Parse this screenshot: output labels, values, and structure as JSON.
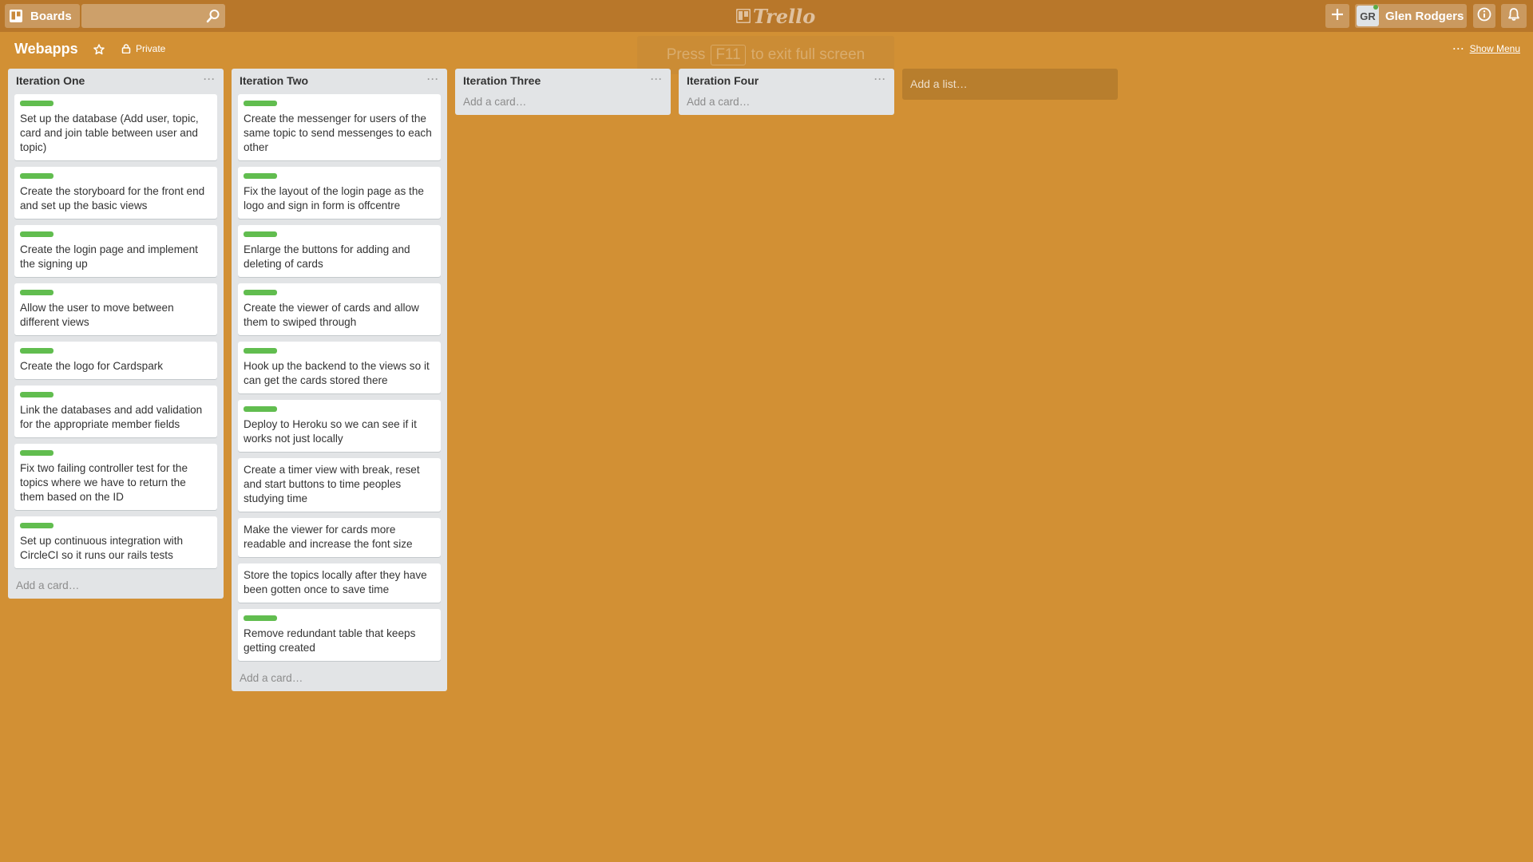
{
  "header": {
    "boards_label": "Boards",
    "search_placeholder": "",
    "logo_text": "Trello",
    "user_initials": "GR",
    "user_name": "Glen Rodgers"
  },
  "board": {
    "title": "Webapps",
    "visibility": "Private",
    "show_menu": "Show Menu",
    "fullscreen_notice": {
      "prefix": "Press",
      "key": "F11",
      "suffix": "to exit full screen"
    }
  },
  "colors": {
    "background": "#d29034",
    "header": "#b8772a",
    "label_green": "#61bd4f",
    "list_bg": "#e2e4e6"
  },
  "lists": [
    {
      "title": "Iteration One",
      "add_card": "Add a card…",
      "cards": [
        {
          "text": "Set up the database (Add user, topic, card and join table between user and topic)",
          "label": "green"
        },
        {
          "text": "Create the storyboard for the front end and set up the basic views",
          "label": "green"
        },
        {
          "text": "Create the login page and implement the signing up",
          "label": "green"
        },
        {
          "text": "Allow the user to move between different views",
          "label": "green"
        },
        {
          "text": "Create the logo for Cardspark",
          "label": "green"
        },
        {
          "text": "Link the databases and add validation for the appropriate member fields",
          "label": "green"
        },
        {
          "text": "Fix two failing controller test for the topics where we have to return the them based on the ID",
          "label": "green"
        },
        {
          "text": "Set up continuous integration with CircleCI so it runs our rails tests",
          "label": "green"
        }
      ]
    },
    {
      "title": "Iteration Two",
      "add_card": "Add a card…",
      "cards": [
        {
          "text": "Create the messenger for users of the same topic to send messenges to each other",
          "label": "green"
        },
        {
          "text": "Fix the layout of the login page as the logo and sign in form is offcentre",
          "label": "green"
        },
        {
          "text": "Enlarge the buttons for adding and deleting of cards",
          "label": "green"
        },
        {
          "text": "Create the viewer of cards and allow them to swiped through",
          "label": "green"
        },
        {
          "text": "Hook up the backend to the views so it can get the cards stored there",
          "label": "green"
        },
        {
          "text": "Deploy to Heroku so we can see if it works not just locally",
          "label": "green"
        },
        {
          "text": "Create a timer view with break, reset and start buttons to time peoples studying time",
          "label": ""
        },
        {
          "text": "Make the viewer for cards more readable and increase the font size",
          "label": ""
        },
        {
          "text": "Store the topics locally after they have been gotten once to save time",
          "label": ""
        },
        {
          "text": "Remove redundant table that keeps getting created",
          "label": "green"
        }
      ]
    },
    {
      "title": "Iteration Three",
      "add_card": "Add a card…",
      "cards": []
    },
    {
      "title": "Iteration Four",
      "add_card": "Add a card…",
      "cards": []
    }
  ],
  "add_list": "Add a list…"
}
